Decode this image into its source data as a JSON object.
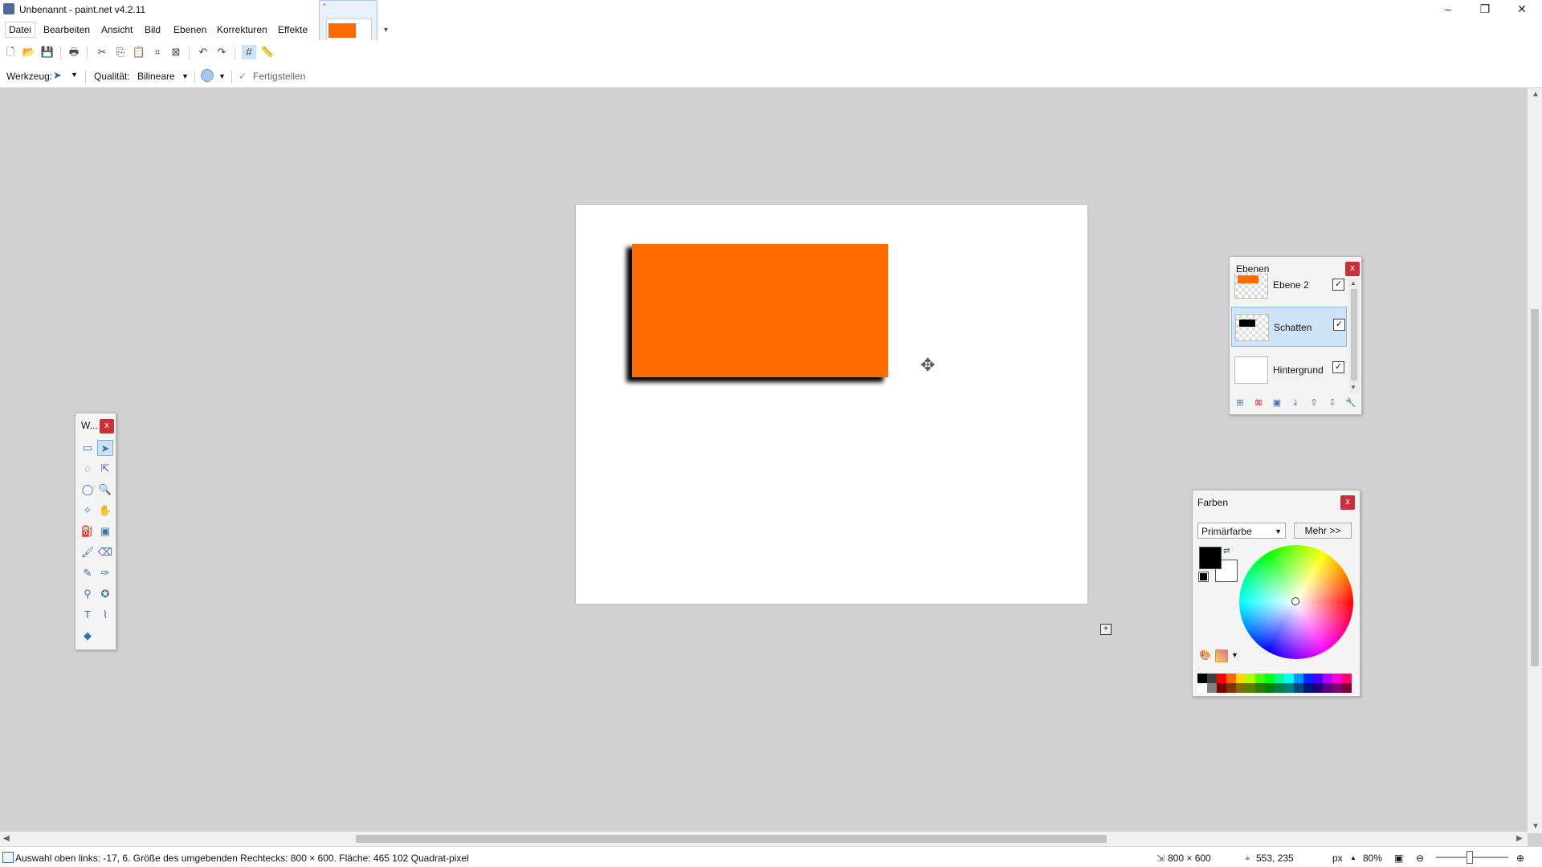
{
  "window": {
    "title": "Unbenannt - paint.net v4.2.11",
    "minimize_glyph": "–",
    "restore_glyph": "❐",
    "close_glyph": "✕"
  },
  "menu": [
    "Datei",
    "Bearbeiten",
    "Ansicht",
    "Bild",
    "Ebenen",
    "Korrekturen",
    "Effekte"
  ],
  "image_tab": {
    "modified_marker": "*",
    "thumbnail_color": "#ff6a00"
  },
  "tool_options": {
    "tool_label": "Werkzeug:",
    "quality_label": "Qualität:",
    "quality_value": "Bilineare",
    "finish_label": "Fertigstellen"
  },
  "canvas": {
    "background": "#ffffff",
    "shape_color": "#ff6b00",
    "shadow_color": "#000000"
  },
  "tools_panel": {
    "title": "W...",
    "close_glyph": "x",
    "tools": [
      {
        "name": "rectangle-select-icon",
        "glyph": "▭"
      },
      {
        "name": "move-selected-pixels-icon",
        "glyph": "➤",
        "active": true
      },
      {
        "name": "lasso-select-icon",
        "glyph": "◌"
      },
      {
        "name": "move-selection-icon",
        "glyph": "⇱"
      },
      {
        "name": "ellipse-select-icon",
        "glyph": "◯"
      },
      {
        "name": "zoom-icon",
        "glyph": "🔍"
      },
      {
        "name": "magic-wand-icon",
        "glyph": "✧"
      },
      {
        "name": "pan-icon",
        "glyph": "✋"
      },
      {
        "name": "paint-bucket-icon",
        "glyph": "⛽"
      },
      {
        "name": "gradient-icon",
        "glyph": "▣"
      },
      {
        "name": "paintbrush-icon",
        "glyph": "🖌"
      },
      {
        "name": "eraser-icon",
        "glyph": "⌫"
      },
      {
        "name": "pencil-icon",
        "glyph": "✎"
      },
      {
        "name": "color-picker-icon",
        "glyph": "✑"
      },
      {
        "name": "clone-stamp-icon",
        "glyph": "⚲"
      },
      {
        "name": "recolor-icon",
        "glyph": "✪"
      },
      {
        "name": "text-icon",
        "glyph": "T"
      },
      {
        "name": "line-curve-icon",
        "glyph": "⌇"
      },
      {
        "name": "shapes-icon",
        "glyph": "◆"
      }
    ]
  },
  "layers_panel": {
    "title": "Ebenen",
    "close_glyph": "x",
    "layers": [
      {
        "name": "Ebene 2",
        "visible": true,
        "selected": false,
        "check_glyph": "✓"
      },
      {
        "name": "Schatten",
        "visible": true,
        "selected": true,
        "check_glyph": "✓"
      },
      {
        "name": "Hintergrund",
        "visible": true,
        "selected": false,
        "check_glyph": "✓"
      }
    ]
  },
  "colors_panel": {
    "title": "Farben",
    "close_glyph": "x",
    "mode_value": "Primärfarbe",
    "more_button": "Mehr >>",
    "primary_color": "#000000",
    "secondary_color": "#ffffff",
    "palette_top": [
      "#000000",
      "#404040",
      "#ff0000",
      "#ff6a00",
      "#ffd800",
      "#b6ff00",
      "#4cff00",
      "#00ff21",
      "#00ff90",
      "#00ffff",
      "#0094ff",
      "#0026ff",
      "#4800ff",
      "#b200ff",
      "#ff00dc",
      "#ff006e"
    ],
    "palette_bottom": [
      "#ffffff",
      "#808080",
      "#7f0000",
      "#7f3300",
      "#7f6a00",
      "#5b7f00",
      "#267f00",
      "#007f0e",
      "#007f46",
      "#007f7f",
      "#004a7f",
      "#00137f",
      "#21007f",
      "#57007f",
      "#7f006e",
      "#7f0037"
    ]
  },
  "statusbar": {
    "selection_info": "Auswahl oben links: -17, 6. Größe des umgebenden Rechtecks: 800 × 600. Fläche: 465 102 Quadrat-pixel",
    "image_size": "800 × 600",
    "cursor_pos": "553, 235",
    "units": "px",
    "zoom": "80%"
  }
}
